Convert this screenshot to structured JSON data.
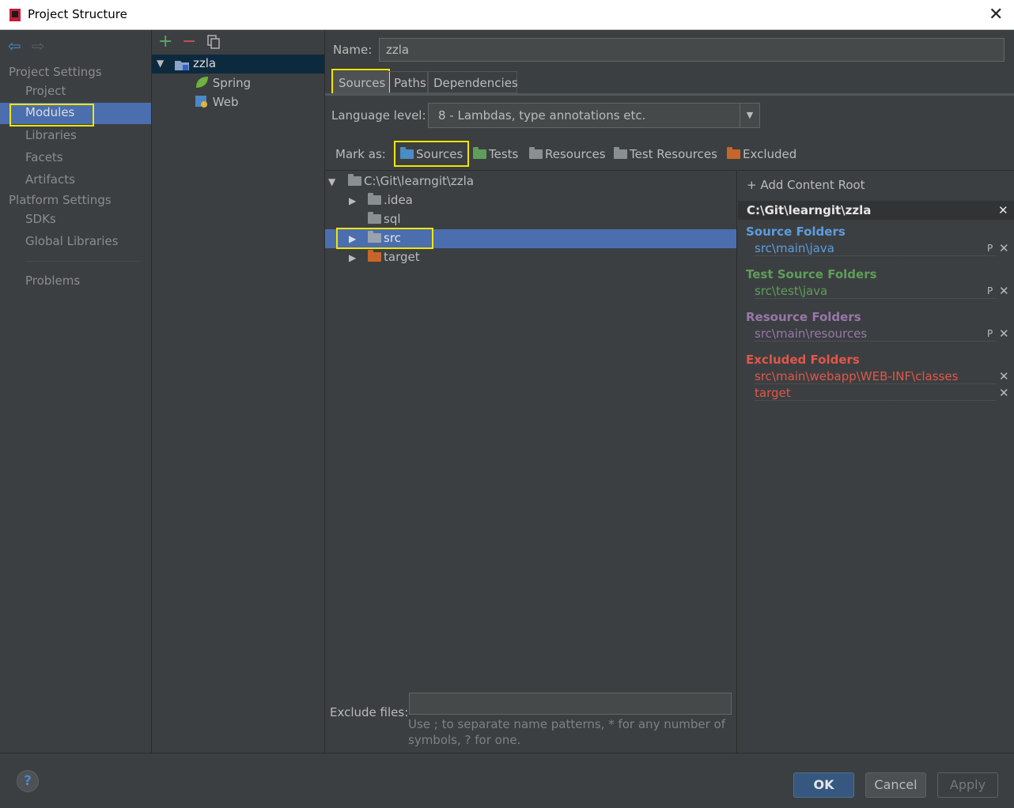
{
  "window": {
    "title": "Project Structure"
  },
  "left_nav": {
    "project_settings": "Project Settings",
    "items": [
      "Project",
      "Modules",
      "Libraries",
      "Facets",
      "Artifacts"
    ],
    "platform_settings": "Platform Settings",
    "platform_items": [
      "SDKs",
      "Global Libraries"
    ],
    "problems": "Problems",
    "selected": "Modules"
  },
  "module_tree": {
    "root": "zzla",
    "children": [
      "Spring",
      "Web"
    ]
  },
  "form": {
    "name_label": "Name:",
    "name_value": "zzla",
    "tabs": [
      "Sources",
      "Paths",
      "Dependencies"
    ],
    "active_tab": "Sources",
    "language_label": "Language level:",
    "language_value": "8 - Lambdas, type annotations etc.",
    "mark_as_label": "Mark as:",
    "mark_buttons": [
      "Sources",
      "Tests",
      "Resources",
      "Test Resources",
      "Excluded"
    ]
  },
  "file_tree": {
    "root": "C:\\Git\\learngit\\zzla",
    "items": [
      ".idea",
      "sql",
      "src",
      "target"
    ],
    "selected": "src"
  },
  "content_root": {
    "add_label": "+ Add Content Root",
    "root_path": "C:\\Git\\learngit\\zzla",
    "source_folders_label": "Source Folders",
    "source_folders": [
      "src\\main\\java"
    ],
    "test_folders_label": "Test Source Folders",
    "test_folders": [
      "src\\test\\java"
    ],
    "resource_folders_label": "Resource Folders",
    "resource_folders": [
      "src\\main\\resources"
    ],
    "excluded_folders_label": "Excluded Folders",
    "excluded_folders": [
      "src\\main\\webapp\\WEB-INF\\classes",
      "target"
    ]
  },
  "exclude": {
    "label": "Exclude files:",
    "value": "",
    "hint_1": "Use ; to separate name patterns, * for any number of",
    "hint_2": "symbols, ? for one."
  },
  "buttons": {
    "ok": "OK",
    "cancel": "Cancel",
    "apply": "Apply",
    "help": "?"
  },
  "colors": {
    "source": "#5c9de0",
    "test": "#5f9e5a",
    "resource": "#9876aa",
    "excluded": "#e0574a",
    "selection": "#4b6eaf",
    "highlight": "#f0e500"
  }
}
